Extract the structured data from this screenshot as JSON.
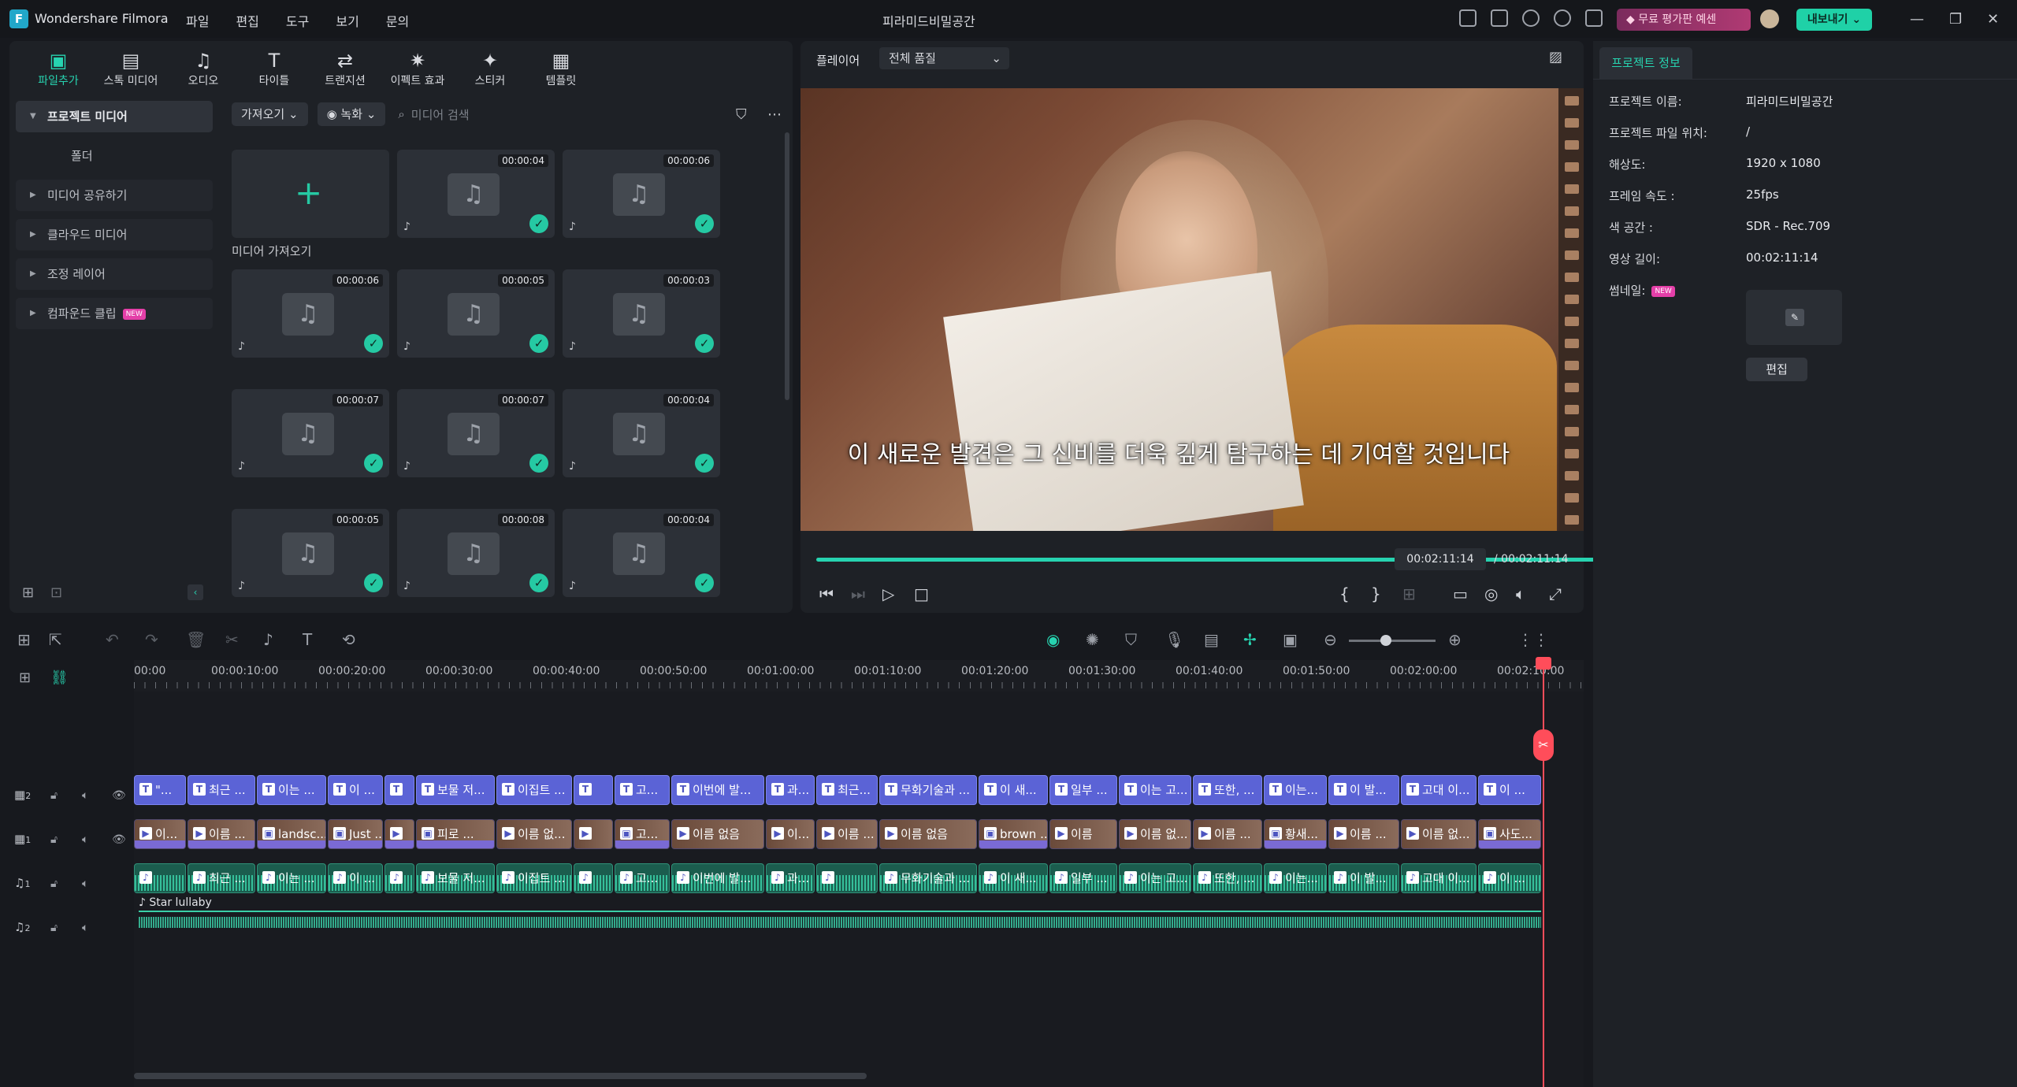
{
  "app": {
    "name": "Wondershare Filmora",
    "window_title": "피라미드비밀공간",
    "menu": [
      "파일",
      "편집",
      "도구",
      "보기",
      "문의"
    ],
    "trial_label": "무료 평가판 예센",
    "export_label": "내보내기"
  },
  "toolbar_tabs": [
    {
      "label": "파일추가",
      "icon": "import-icon"
    },
    {
      "label": "스톡 미디어",
      "icon": "stock-media-icon"
    },
    {
      "label": "오디오",
      "icon": "audio-icon"
    },
    {
      "label": "타이틀",
      "icon": "title-icon"
    },
    {
      "label": "트랜지션",
      "icon": "transition-icon"
    },
    {
      "label": "이펙트 효과",
      "icon": "effects-icon"
    },
    {
      "label": "스티커",
      "icon": "sticker-icon"
    },
    {
      "label": "템플릿",
      "icon": "template-icon"
    }
  ],
  "sidebar": {
    "items": [
      {
        "label": "프로젝트 미디어"
      },
      {
        "label": "폴더"
      },
      {
        "label": "미디어 공유하기"
      },
      {
        "label": "클라우드 미디어"
      },
      {
        "label": "조정 레이어"
      },
      {
        "label": "컴파운드 클립",
        "badge": "NEW"
      }
    ]
  },
  "media": {
    "import_label": "가져오기",
    "record_label": "녹화",
    "search_placeholder": "미디어 검색",
    "add_label": "미디어 가져오기",
    "items": [
      "00:00:04",
      "00:00:06",
      "00:00:06",
      "00:00:05",
      "00:00:03",
      "00:00:07",
      "00:00:07",
      "00:00:04",
      "00:00:05",
      "00:00:08",
      "00:00:04"
    ]
  },
  "player": {
    "label": "플레이어",
    "quality": "전체 품질",
    "subtitle": "이 새로운 발견은 그 신비를 더욱 깊게 탐구하는 데 기여할 것입니다",
    "current_time": "00:02:11:14",
    "total_time": "/ 00:02:11:14",
    "progress": 1.0
  },
  "project_info": {
    "tab": "프로젝트 정보",
    "rows": [
      {
        "label": "프로젝트 이름:",
        "value": "피라미드비밀공간"
      },
      {
        "label": "프로젝트 파일 위치:",
        "value": "/"
      },
      {
        "label": "해상도:",
        "value": "1920 x 1080"
      },
      {
        "label": "프레임 속도 :",
        "value": "25fps"
      },
      {
        "label": "색 공간 :",
        "value": "SDR - Rec.709"
      },
      {
        "label": "영상 길이:",
        "value": "00:02:11:14"
      }
    ],
    "thumbnail_label": "썸네일:",
    "thumbnail_badge": "NEW",
    "edit_label": "편집"
  },
  "timeline": {
    "ruler": [
      "00:00",
      "00:00:10:00",
      "00:00:20:00",
      "00:00:30:00",
      "00:00:40:00",
      "00:00:50:00",
      "00:01:00:00",
      "00:01:10:00",
      "00:01:20:00",
      "00:01:30:00",
      "00:01:40:00",
      "00:01:50:00",
      "00:02:00:00",
      "00:02:10:00"
    ],
    "tracks": [
      {
        "name": "2",
        "type": "title"
      },
      {
        "name": "1",
        "type": "video"
      },
      {
        "name": "1",
        "type": "audio"
      },
      {
        "name": "2",
        "type": "music"
      }
    ],
    "title_clips": [
      "\"...",
      "최근 ...",
      "이는 ...",
      "이 ...",
      "",
      "보물 저...",
      "이집트 ...",
      "",
      "고...",
      "이번에 발...",
      "과...",
      "최근...",
      "무화기술과 ...",
      "이 새...",
      "일부 ...",
      "이는 고...",
      "또한, ...",
      "이는...",
      "이 발...",
      "고대 이...",
      "이 ..."
    ],
    "video_clips": [
      "이...",
      "이름 ...",
      "landsc...",
      "Just ...",
      "",
      "피로 ...",
      "이름 없...",
      "",
      "고...",
      "이름 없음",
      "이...",
      "이름 ...",
      "이름 없음",
      "brown ...",
      "이름",
      "이름 없...",
      "이름 ...",
      "황새...",
      "이름 ...",
      "이름 없...",
      "사도..."
    ],
    "audio_clips": [
      "",
      "최근 ...",
      "이는 ...",
      "이 ...",
      "",
      "보물 저...",
      "이집트 ...",
      "",
      "고...",
      "이번에 발...",
      "과...",
      "",
      "무화기술과 ...",
      "이 새...",
      "일부 ...",
      "이는 고...",
      "또한, ...",
      "이는...",
      "이 발...",
      "고대 이...",
      "이 ..."
    ],
    "music_clip": "Star lullaby"
  },
  "colors": {
    "accent": "#27d3b0",
    "title_clip": "#5b63d6",
    "playhead": "#ff4d5a"
  }
}
